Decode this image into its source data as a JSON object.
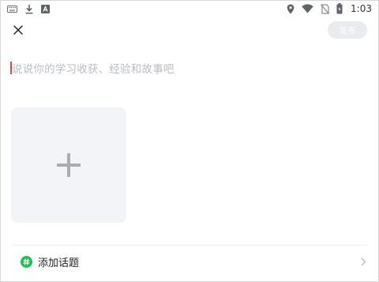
{
  "status_bar": {
    "time": "1:03",
    "icons_left": [
      "keyboard-icon",
      "download-icon",
      "font-a-icon"
    ],
    "icons_right": [
      "location-icon",
      "wifi-icon",
      "no-sim-icon",
      "battery-icon"
    ]
  },
  "header": {
    "close_icon": "close-icon",
    "publish_label": "发布"
  },
  "composer": {
    "placeholder": "说说你的学习收获、经验和故事吧",
    "value": ""
  },
  "media": {
    "add_icon": "plus-icon"
  },
  "topic": {
    "label": "添加话题",
    "icon": "hashtag-icon",
    "chevron": "chevron-right-icon"
  },
  "colors": {
    "accent_green": "#1fbd54",
    "caret_red": "#e0463c",
    "publish_disabled_bg": "#e9ebee",
    "placeholder": "#b9bcc2",
    "tile_bg": "#f3f4f7"
  }
}
